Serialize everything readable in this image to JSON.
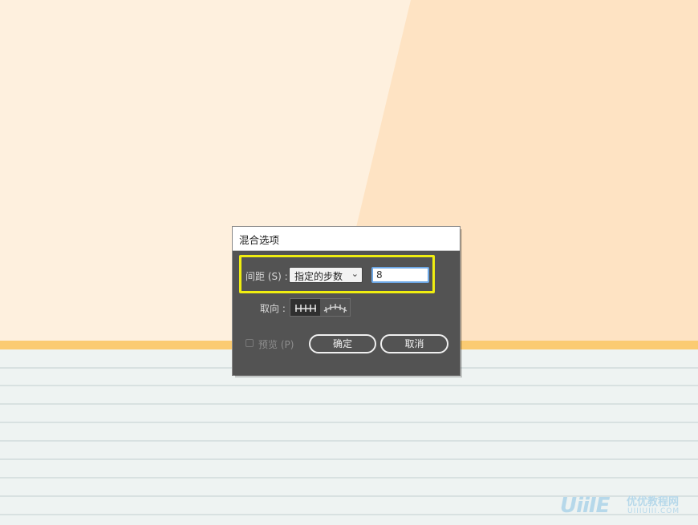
{
  "dialog": {
    "title": "混合选项",
    "spacing": {
      "label": "间距 (S) :",
      "selected_option": "指定的步数",
      "value": "8"
    },
    "orientation": {
      "label": "取向 :"
    },
    "preview": {
      "label": "预览 (P)",
      "checked": false
    },
    "buttons": {
      "ok": "确定",
      "cancel": "取消"
    }
  },
  "watermark": {
    "logo": "UiiIE",
    "name_cn": "优优教程网",
    "url": "UIIIUIII.COM"
  },
  "colors": {
    "dialog_bg": "#535353",
    "highlight": "#f0ee10",
    "input_focus": "#6ea8e6",
    "wall_light": "#fef0de",
    "wall_shade": "#fee3c3",
    "stripe": "#fbcb72",
    "floor": "#eef3f2"
  },
  "icons": {
    "orientation_page": "align-to-page-icon",
    "orientation_path": "align-to-path-icon",
    "select_arrow": "chevron-down-icon"
  }
}
